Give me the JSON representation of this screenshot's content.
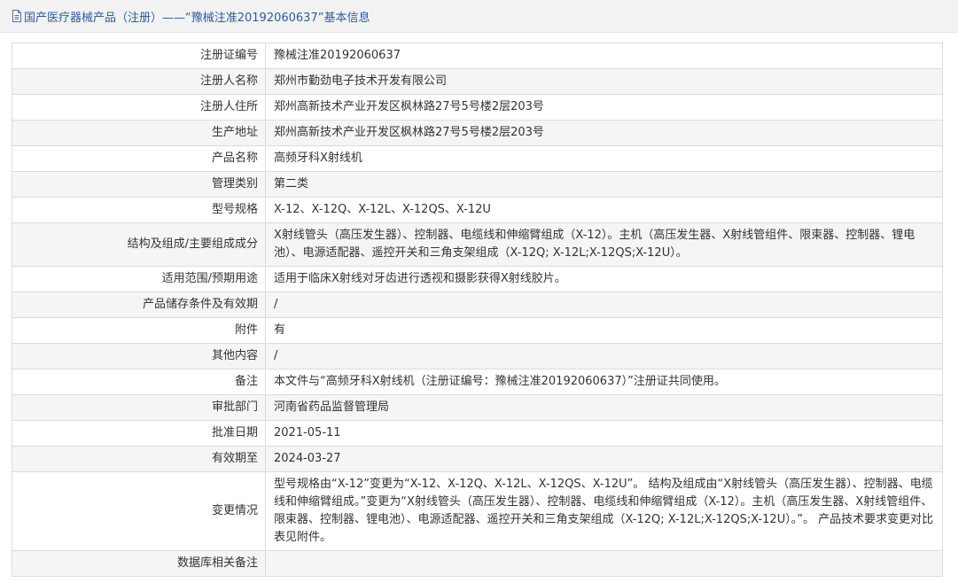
{
  "header": {
    "icon": "document-icon",
    "title": "国产医疗器械产品（注册）——“豫械注准20192060637”基本信息"
  },
  "colors": {
    "title_text": "#2b5c9e",
    "header_bg": "#f2f2f2",
    "row_alt_bg": "#f5f5f5",
    "border": "#dcdcdc",
    "text": "#333333"
  },
  "rows": [
    {
      "label": "注册证编号",
      "value": "豫械注准20192060637"
    },
    {
      "label": "注册人名称",
      "value": "郑州市勤劲电子技术开发有限公司"
    },
    {
      "label": "注册人住所",
      "value": "郑州高新技术产业开发区枫林路27号5号楼2层203号"
    },
    {
      "label": "生产地址",
      "value": "郑州高新技术产业开发区枫林路27号5号楼2层203号"
    },
    {
      "label": "产品名称",
      "value": "高频牙科X射线机"
    },
    {
      "label": "管理类别",
      "value": "第二类"
    },
    {
      "label": "型号规格",
      "value": "X-12、X-12Q、X-12L、X-12QS、X-12U"
    },
    {
      "label": "结构及组成/主要组成成分",
      "value": "X射线管头（高压发生器）、控制器、电缆线和伸缩臂组成（X-12）。主机（高压发生器、X射线管组件、限束器、控制器、锂电池）、电源适配器、遥控开关和三角支架组成（X-12Q; X-12L;X-12QS;X-12U）。"
    },
    {
      "label": "适用范围/预期用途",
      "value": "适用于临床X射线对牙齿进行透视和摄影获得X射线胶片。"
    },
    {
      "label": "产品储存条件及有效期",
      "value": "/"
    },
    {
      "label": "附件",
      "value": "有"
    },
    {
      "label": "其他内容",
      "value": "/"
    },
    {
      "label": "备注",
      "value": "本文件与“高频牙科X射线机（注册证编号：豫械注准20192060637）”注册证共同使用。"
    },
    {
      "label": "审批部门",
      "value": "河南省药品监督管理局"
    },
    {
      "label": "批准日期",
      "value": "2021-05-11"
    },
    {
      "label": "有效期至",
      "value": "2024-03-27"
    },
    {
      "label": "变更情况",
      "value": "型号规格由“X-12”变更为“X-12、X-12Q、X-12L、X-12QS、X-12U”。 结构及组成由“X射线管头（高压发生器）、控制器、电缆线和伸缩臂组成。”变更为“X射线管头（高压发生器）、控制器、电缆线和伸缩臂组成（X-12）。主机（高压发生器、X射线管组件、限束器、控制器、锂电池）、电源适配器、遥控开关和三角支架组成（X-12Q; X-12L;X-12QS;X-12U）。”。 产品技术要求变更对比表见附件。"
    },
    {
      "label": "数据库相关备注",
      "value": ""
    }
  ]
}
